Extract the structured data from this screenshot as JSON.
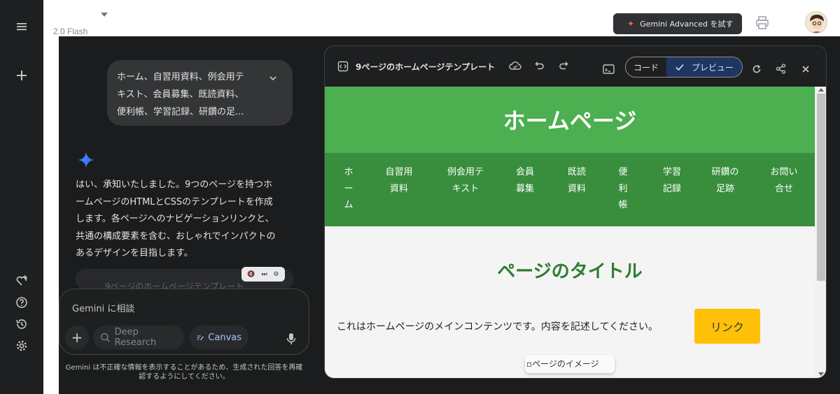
{
  "header": {
    "model_label": "2.0 Flash",
    "advanced_button": "Gemini Advanced を試す"
  },
  "chat": {
    "user_prompt_lines": [
      "ホーム、自習用資料、例会用テ",
      "キスト、会員募集、既読資料、",
      "便利帳、学習記録、研鑽の足..."
    ],
    "reply_lines": [
      "はい、承知いたしました。9つのページを持つホ",
      "ームページのHTMLとCSSのテンプレートを作成",
      "します。各ページへのナビゲーションリンクと、",
      "共通の構成要素を含む、おしゃれでインパクトの",
      "あるデザインを目指します。"
    ],
    "canvas_chip_label": "9ページのホームページテンプレート"
  },
  "input": {
    "placeholder": "Gemini に相談",
    "deep_research_label": "Deep Research",
    "canvas_label": "Canvas"
  },
  "disclaimer_lines": [
    "Gemini は不正確な情報を表示することがあるため、生成された回答を再確",
    "認するようにしてください。"
  ],
  "panel": {
    "title": "9ページのホームページテンプレート",
    "code_tab": "コード",
    "preview_tab": "プレビュー"
  },
  "preview": {
    "site_title": "ホームページ",
    "nav": [
      {
        "id": "home",
        "lines": [
          "ホ",
          "ー",
          "ム"
        ]
      },
      {
        "id": "self-study",
        "lines": [
          "自習用",
          "資料"
        ]
      },
      {
        "id": "meeting-text",
        "lines": [
          "例会用テ",
          "キスト"
        ]
      },
      {
        "id": "members",
        "lines": [
          "会員",
          "募集"
        ]
      },
      {
        "id": "read",
        "lines": [
          "既読",
          "資料"
        ]
      },
      {
        "id": "handbook",
        "lines": [
          "便",
          "利",
          "帳"
        ]
      },
      {
        "id": "study-log",
        "lines": [
          "学習",
          "記録"
        ]
      },
      {
        "id": "footprints",
        "lines": [
          "研鑽の",
          "足跡"
        ]
      },
      {
        "id": "contact",
        "lines": [
          "お問い",
          "合せ"
        ]
      }
    ],
    "page_title": "ページのタイトル",
    "main_text": "これはホームページのメインコンテンツです。内容を記述してください。",
    "link_label": "リンク",
    "image_alt": "ページのイメージ"
  },
  "colors": {
    "site_header": "#4caf50",
    "site_nav": "#388e3c",
    "page_title": "#2e7d32",
    "link_button": "#ffc107",
    "canvas_accent": "#a8c7fa"
  }
}
